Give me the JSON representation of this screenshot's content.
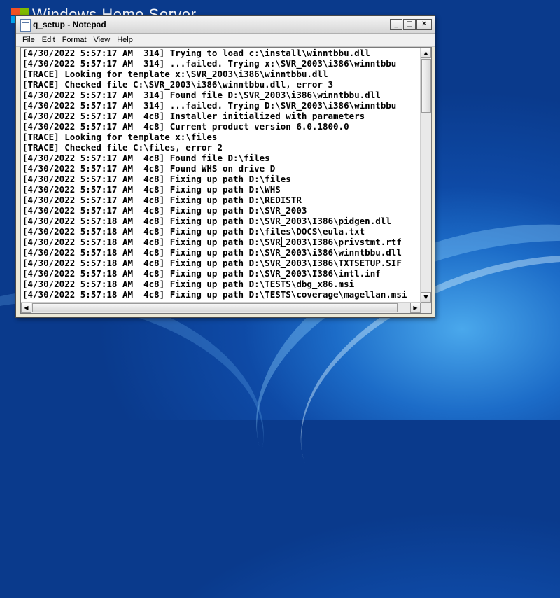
{
  "desktop": {
    "title": "Windows Home Server"
  },
  "window": {
    "title": "q_setup - Notepad",
    "buttons": {
      "minimize": "_",
      "maximize": "□",
      "close": "✕"
    }
  },
  "menu": [
    "File",
    "Edit",
    "Format",
    "View",
    "Help"
  ],
  "lines": [
    "[4/30/2022 5:57:17 AM  314] Trying to load c:\\install\\winntbbu.dll",
    "[4/30/2022 5:57:17 AM  314] ...failed. Trying x:\\SVR_2003\\i386\\winntbbu",
    "[TRACE] Looking for template x:\\SVR_2003\\i386\\winntbbu.dll",
    "[TRACE] Checked file C:\\SVR_2003\\i386\\winntbbu.dll, error 3",
    "[4/30/2022 5:57:17 AM  314] Found file D:\\SVR_2003\\i386\\winntbbu.dll",
    "[4/30/2022 5:57:17 AM  314] ...failed. Trying D:\\SVR_2003\\i386\\winntbbu",
    "[4/30/2022 5:57:17 AM  4c8] Installer initialized with parameters",
    "[4/30/2022 5:57:17 AM  4c8] Current product version 6.0.1800.0",
    "[TRACE] Looking for template x:\\files",
    "[TRACE] Checked file C:\\files, error 2",
    "[4/30/2022 5:57:17 AM  4c8] Found file D:\\files",
    "[4/30/2022 5:57:17 AM  4c8] Found WHS on drive D",
    "[4/30/2022 5:57:17 AM  4c8] Fixing up path D:\\files",
    "[4/30/2022 5:57:17 AM  4c8] Fixing up path D:\\WHS",
    "[4/30/2022 5:57:17 AM  4c8] Fixing up path D:\\REDISTR",
    "[4/30/2022 5:57:17 AM  4c8] Fixing up path D:\\SVR_2003",
    "[4/30/2022 5:57:18 AM  4c8] Fixing up path D:\\SVR_2003\\I386\\pidgen.dll",
    "[4/30/2022 5:57:18 AM  4c8] Fixing up path D:\\files\\DOCS\\eula.txt",
    "[4/30/2022 5:57:18 AM  4c8] Fixing up path D:\\SVR_2003\\I386\\privstmt.rtf",
    "[4/30/2022 5:57:18 AM  4c8] Fixing up path D:\\SVR_2003\\i386\\winntbbu.dll",
    "[4/30/2022 5:57:18 AM  4c8] Fixing up path D:\\SVR_2003\\I386\\TXTSETUP.SIF",
    "[4/30/2022 5:57:18 AM  4c8] Fixing up path D:\\SVR_2003\\I386\\intl.inf",
    "[4/30/2022 5:57:18 AM  4c8] Fixing up path D:\\TESTS\\dbg_x86.msi",
    "[4/30/2022 5:57:18 AM  4c8] Fixing up path D:\\TESTS\\coverage\\magellan.msi"
  ],
  "scrollbars": {
    "up": "▲",
    "down": "▼",
    "left": "◀",
    "right": "▶"
  },
  "colors": {
    "desktop": "#1c6cc8",
    "window_frame": "#ece9d8",
    "text": "#000000"
  }
}
